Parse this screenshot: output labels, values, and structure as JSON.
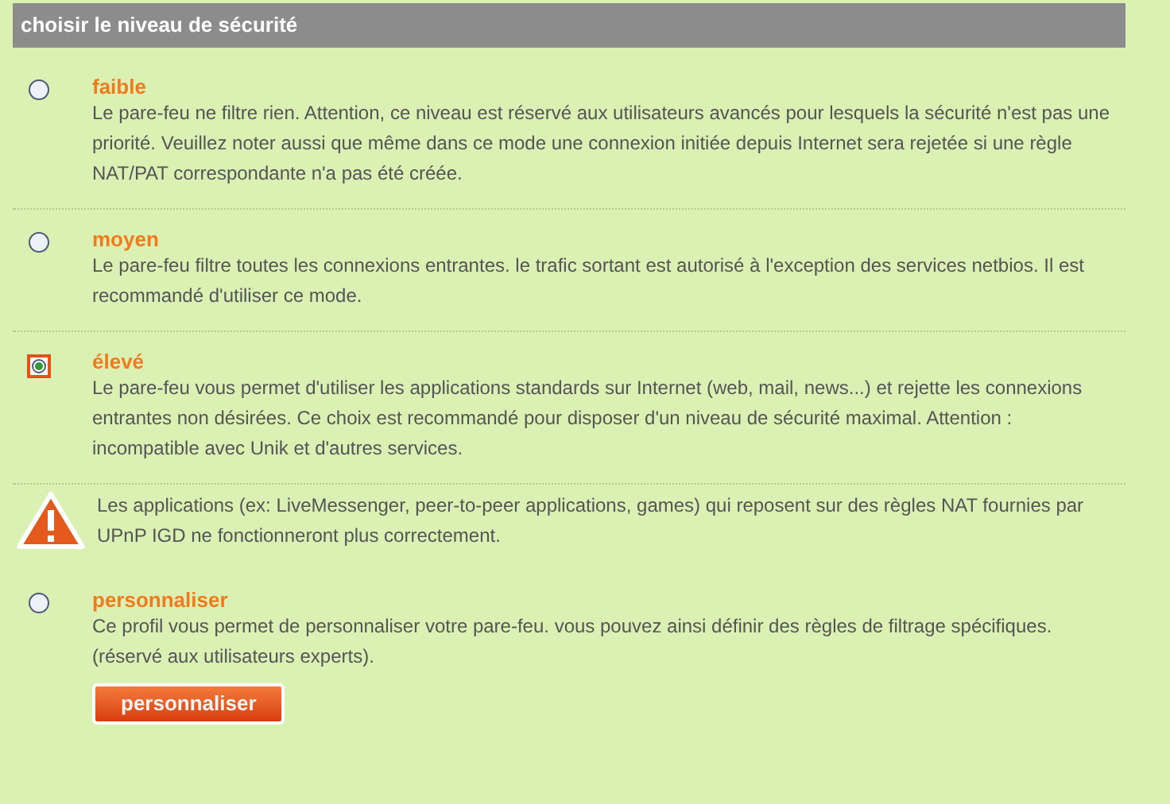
{
  "header": {
    "title": "choisir le niveau de sécurité"
  },
  "options": [
    {
      "label": "faible",
      "selected": false,
      "description": "Le pare-feu ne filtre rien. Attention, ce niveau est réservé aux utilisateurs avancés pour lesquels la sécurité n'est pas une priorité. Veuillez noter aussi que même dans ce mode une connexion initiée depuis Internet sera rejetée si une règle NAT/PAT correspondante n'a pas été créée."
    },
    {
      "label": "moyen",
      "selected": false,
      "description": "Le pare-feu filtre toutes les connexions entrantes. le trafic sortant est autorisé à l'exception des services netbios. Il est recommandé d'utiliser ce mode."
    },
    {
      "label": "élevé",
      "selected": true,
      "description": "Le pare-feu vous permet d'utiliser les applications standards sur Internet (web, mail, news...) et rejette les connexions entrantes non désirées. Ce choix est recommandé pour disposer d'un niveau de sécurité maximal. Attention : incompatible avec Unik et d'autres services.",
      "warning": "Les applications (ex: LiveMessenger, peer-to-peer applications, games) qui reposent sur des règles NAT fournies par UPnP IGD ne fonctionneront plus correctement."
    },
    {
      "label": "personnaliser",
      "selected": false,
      "description": "Ce profil vous permet de personnaliser votre pare-feu. vous pouvez ainsi définir des règles de filtrage spécifiques. (réservé aux utilisateurs experts).",
      "button": "personnaliser"
    }
  ]
}
